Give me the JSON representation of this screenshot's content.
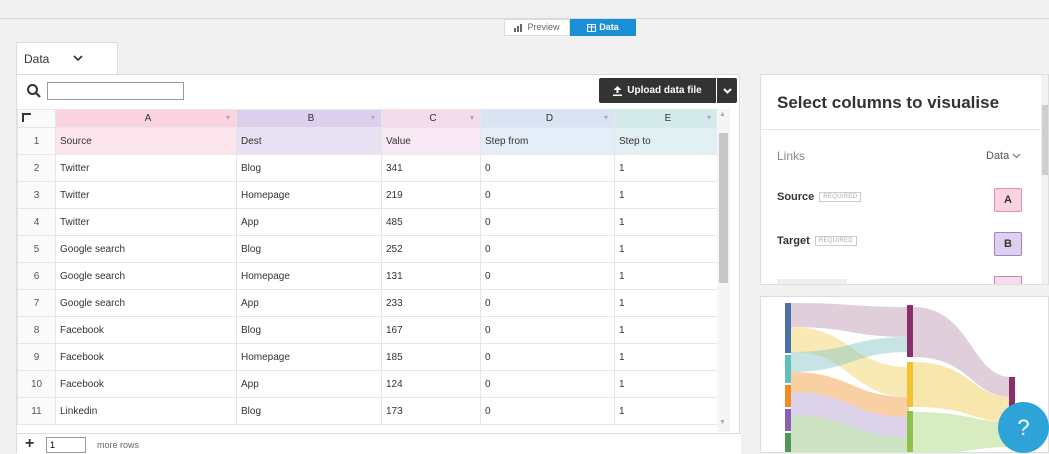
{
  "toggle": {
    "preview_label": "Preview",
    "data_label": "Data"
  },
  "sheet_tab": {
    "label": "Data"
  },
  "toolbar": {
    "search_value": "",
    "upload_label": "Upload data file"
  },
  "grid": {
    "columns": [
      "A",
      "B",
      "C",
      "D",
      "E"
    ],
    "row_numbers": [
      "1",
      "2",
      "3",
      "4",
      "5",
      "6",
      "7",
      "8",
      "9",
      "10",
      "11"
    ],
    "rows": [
      [
        "Source",
        "Dest",
        "Value",
        "Step from",
        "Step to"
      ],
      [
        "Twitter",
        "Blog",
        "341",
        "0",
        "1"
      ],
      [
        "Twitter",
        "Homepage",
        "219",
        "0",
        "1"
      ],
      [
        "Twitter",
        "App",
        "485",
        "0",
        "1"
      ],
      [
        "Google search",
        "Blog",
        "252",
        "0",
        "1"
      ],
      [
        "Google search",
        "Homepage",
        "131",
        "0",
        "1"
      ],
      [
        "Google search",
        "App",
        "233",
        "0",
        "1"
      ],
      [
        "Facebook",
        "Blog",
        "167",
        "0",
        "1"
      ],
      [
        "Facebook",
        "Homepage",
        "185",
        "0",
        "1"
      ],
      [
        "Facebook",
        "App",
        "124",
        "0",
        "1"
      ],
      [
        "Linkedin",
        "Blog",
        "173",
        "0",
        "1"
      ]
    ]
  },
  "footer": {
    "rows_value": "1",
    "more_rows_label": "more rows"
  },
  "right_panel": {
    "title": "Select columns to visualise",
    "section_label": "Links",
    "sheet_select": "Data",
    "source_label": "Source",
    "target_label": "Target",
    "required_tag": "REQUIRED",
    "source_col": "A",
    "target_col": "B"
  },
  "help": {
    "label": "?"
  },
  "colors": {
    "accent": "#1a8fd6",
    "col_a": "#fbd3e0",
    "col_b": "#ddd0ee",
    "col_c": "#f3dced",
    "col_d": "#d8e3f3",
    "col_e": "#d4ebee",
    "help": "#2ea3d8"
  }
}
